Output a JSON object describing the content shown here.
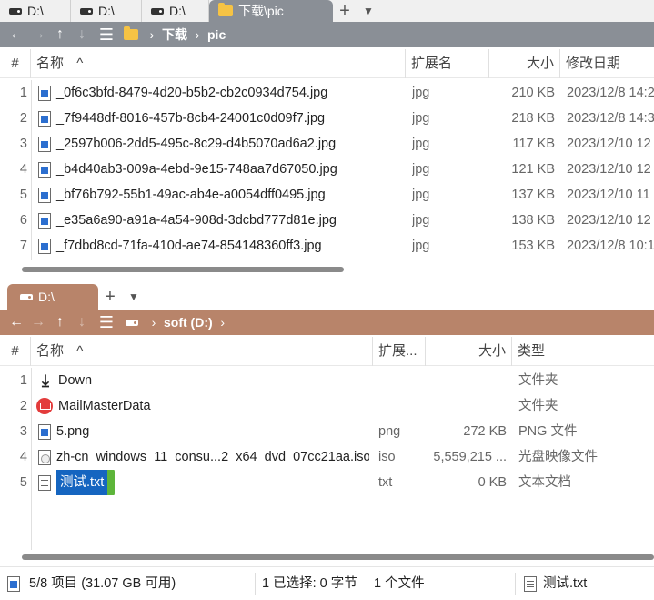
{
  "top_pane": {
    "tabs": [
      {
        "label": "D:\\",
        "icon": "drive-icon"
      },
      {
        "label": "D:\\",
        "icon": "drive-icon"
      },
      {
        "label": "D:\\",
        "icon": "drive-icon"
      },
      {
        "label": "下载\\pic",
        "icon": "folder-icon",
        "active": true
      }
    ],
    "address": {
      "crumbs": [
        "下载",
        "pic"
      ]
    },
    "columns": {
      "num": "#",
      "name": "名称",
      "ext": "扩展名",
      "size": "大小",
      "date": "修改日期"
    },
    "rows": [
      {
        "num": "1",
        "name": "_0f6c3bfd-8479-4d20-b5b2-cb2c0934d754.jpg",
        "ext": "jpg",
        "size": "210 KB",
        "date": "2023/12/8 14:2"
      },
      {
        "num": "2",
        "name": "_7f9448df-8016-457b-8cb4-24001c0d09f7.jpg",
        "ext": "jpg",
        "size": "218 KB",
        "date": "2023/12/8 14:3"
      },
      {
        "num": "3",
        "name": "_2597b006-2dd5-495c-8c29-d4b5070ad6a2.jpg",
        "ext": "jpg",
        "size": "117 KB",
        "date": "2023/12/10 12"
      },
      {
        "num": "4",
        "name": "_b4d40ab3-009a-4ebd-9e15-748aa7d67050.jpg",
        "ext": "jpg",
        "size": "121 KB",
        "date": "2023/12/10 12"
      },
      {
        "num": "5",
        "name": "_bf76b792-55b1-49ac-ab4e-a0054dff0495.jpg",
        "ext": "jpg",
        "size": "137 KB",
        "date": "2023/12/10 11"
      },
      {
        "num": "6",
        "name": "_e35a6a90-a91a-4a54-908d-3dcbd777d81e.jpg",
        "ext": "jpg",
        "size": "138 KB",
        "date": "2023/12/10 12"
      },
      {
        "num": "7",
        "name": "_f7dbd8cd-71fa-410d-ae74-854148360ff3.jpg",
        "ext": "jpg",
        "size": "153 KB",
        "date": "2023/12/8 10:1"
      }
    ]
  },
  "bottom_pane": {
    "tabs": [
      {
        "label": "D:\\",
        "icon": "drive-icon",
        "active": true
      }
    ],
    "address": {
      "crumbs": [
        "soft (D:)"
      ]
    },
    "columns": {
      "num": "#",
      "name": "名称",
      "ext": "扩展...",
      "size": "大小",
      "type": "类型"
    },
    "rows": [
      {
        "num": "1",
        "name": "Down",
        "ext": "",
        "size": "",
        "type": "文件夹",
        "icon": "download-folder-icon"
      },
      {
        "num": "2",
        "name": "MailMasterData",
        "ext": "",
        "size": "",
        "type": "文件夹",
        "icon": "mailmaster-icon"
      },
      {
        "num": "3",
        "name": "5.png",
        "ext": "png",
        "size": "272 KB",
        "type": "PNG 文件",
        "icon": "image-file-icon"
      },
      {
        "num": "4",
        "name": "zh-cn_windows_11_consu...2_x64_dvd_07cc21aa.iso",
        "ext": "iso",
        "size": "5,559,215 ...",
        "type": "光盘映像文件",
        "icon": "disc-image-icon"
      },
      {
        "num": "5",
        "name": "测试.txt",
        "ext": "txt",
        "size": "0 KB",
        "type": "文本文档",
        "icon": "text-file-icon",
        "selected": true
      }
    ]
  },
  "status": {
    "items": "5/8 项目 (31.07 GB 可用)",
    "selection": "1 已选择: 0 字节",
    "file_count": "1 个文件",
    "selected_file": "测试.txt"
  },
  "colors": {
    "top_accent": "#8a8f96",
    "bottom_accent": "#b8846a",
    "selection": "#1565c0",
    "selection_edge": "#5db53a"
  }
}
